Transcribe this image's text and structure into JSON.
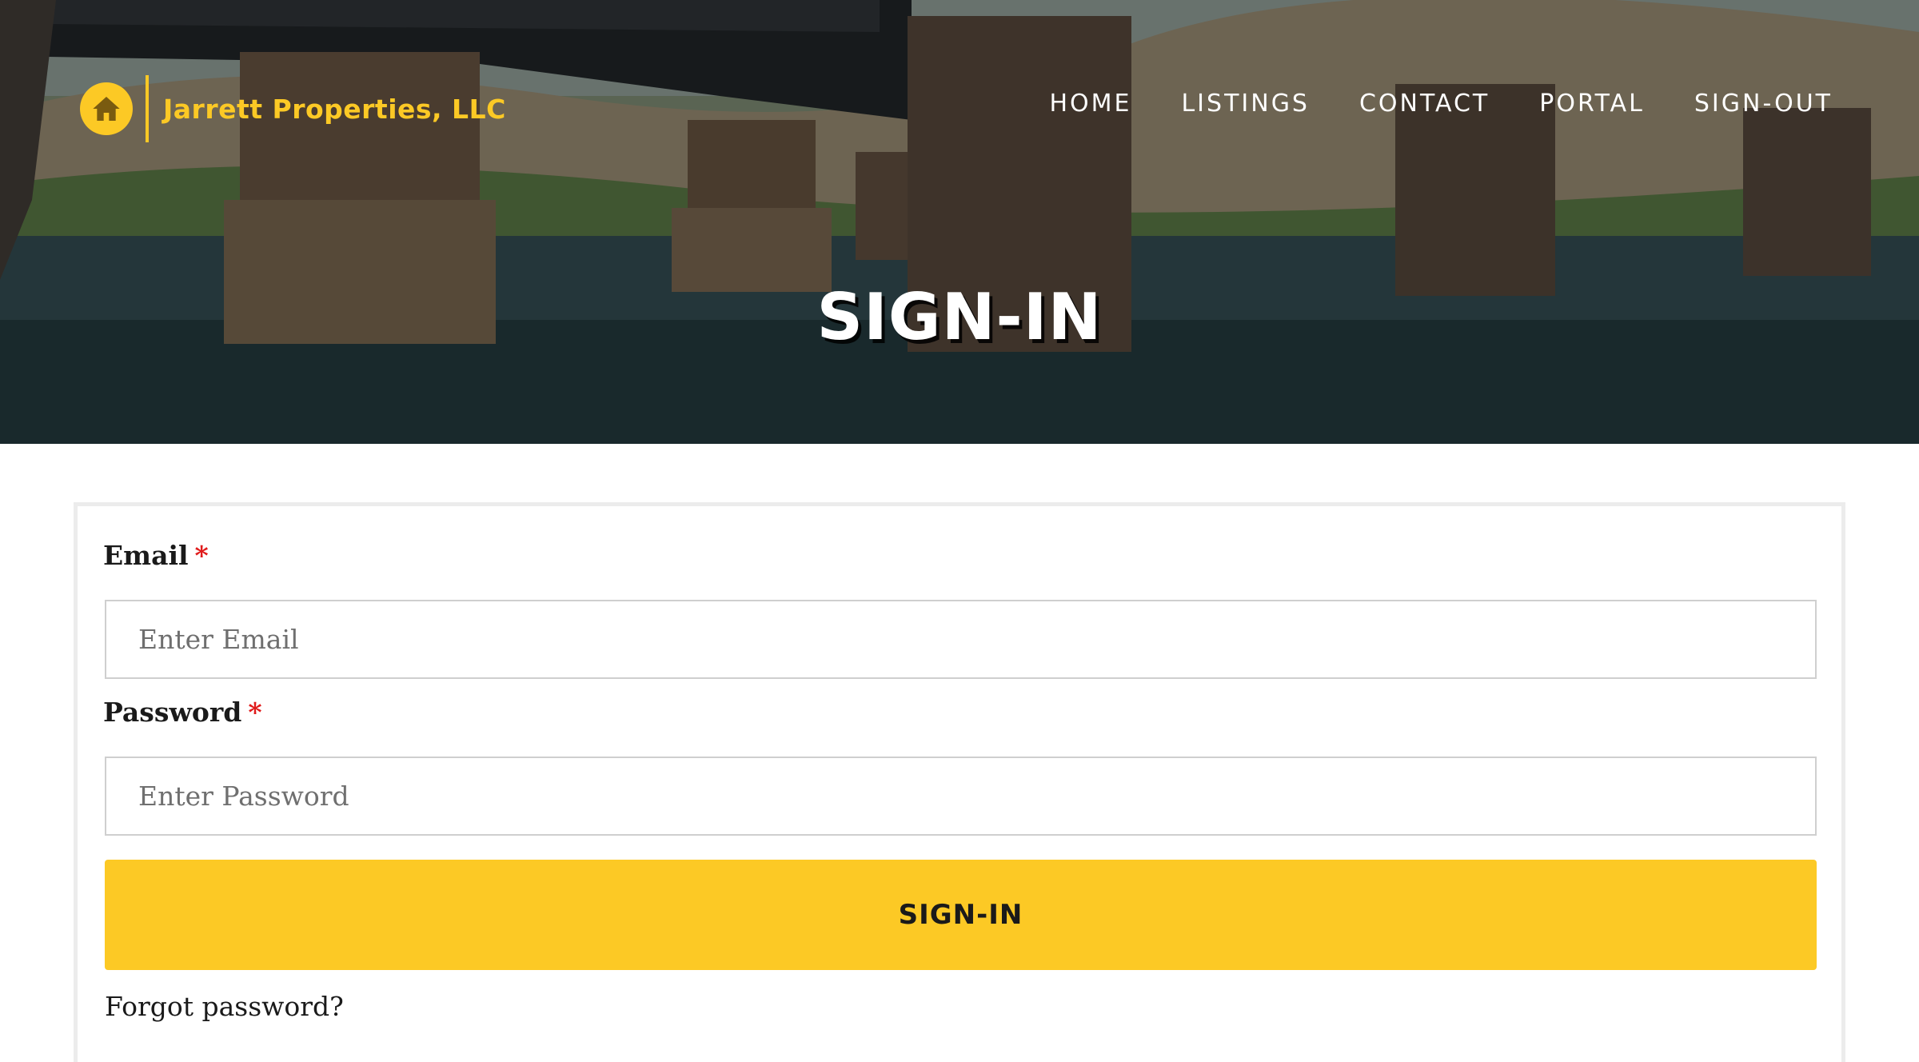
{
  "brand": {
    "name": "Jarrett Properties, LLC",
    "logo_icon": "house-icon",
    "color": "#fcc925"
  },
  "nav": {
    "items": [
      {
        "label": "HOME"
      },
      {
        "label": "LISTINGS"
      },
      {
        "label": "CONTACT"
      },
      {
        "label": "PORTAL"
      },
      {
        "label": "SIGN-OUT"
      }
    ]
  },
  "hero": {
    "title": "SIGN-IN"
  },
  "form": {
    "email_label": "Email",
    "email_placeholder": "Enter Email",
    "password_label": "Password",
    "password_placeholder": "Enter Password",
    "required_marker": "*",
    "submit_label": "SIGN-IN",
    "forgot_label": "Forgot password?",
    "accent_color": "#fcc925",
    "required_color": "#e01b1b"
  }
}
